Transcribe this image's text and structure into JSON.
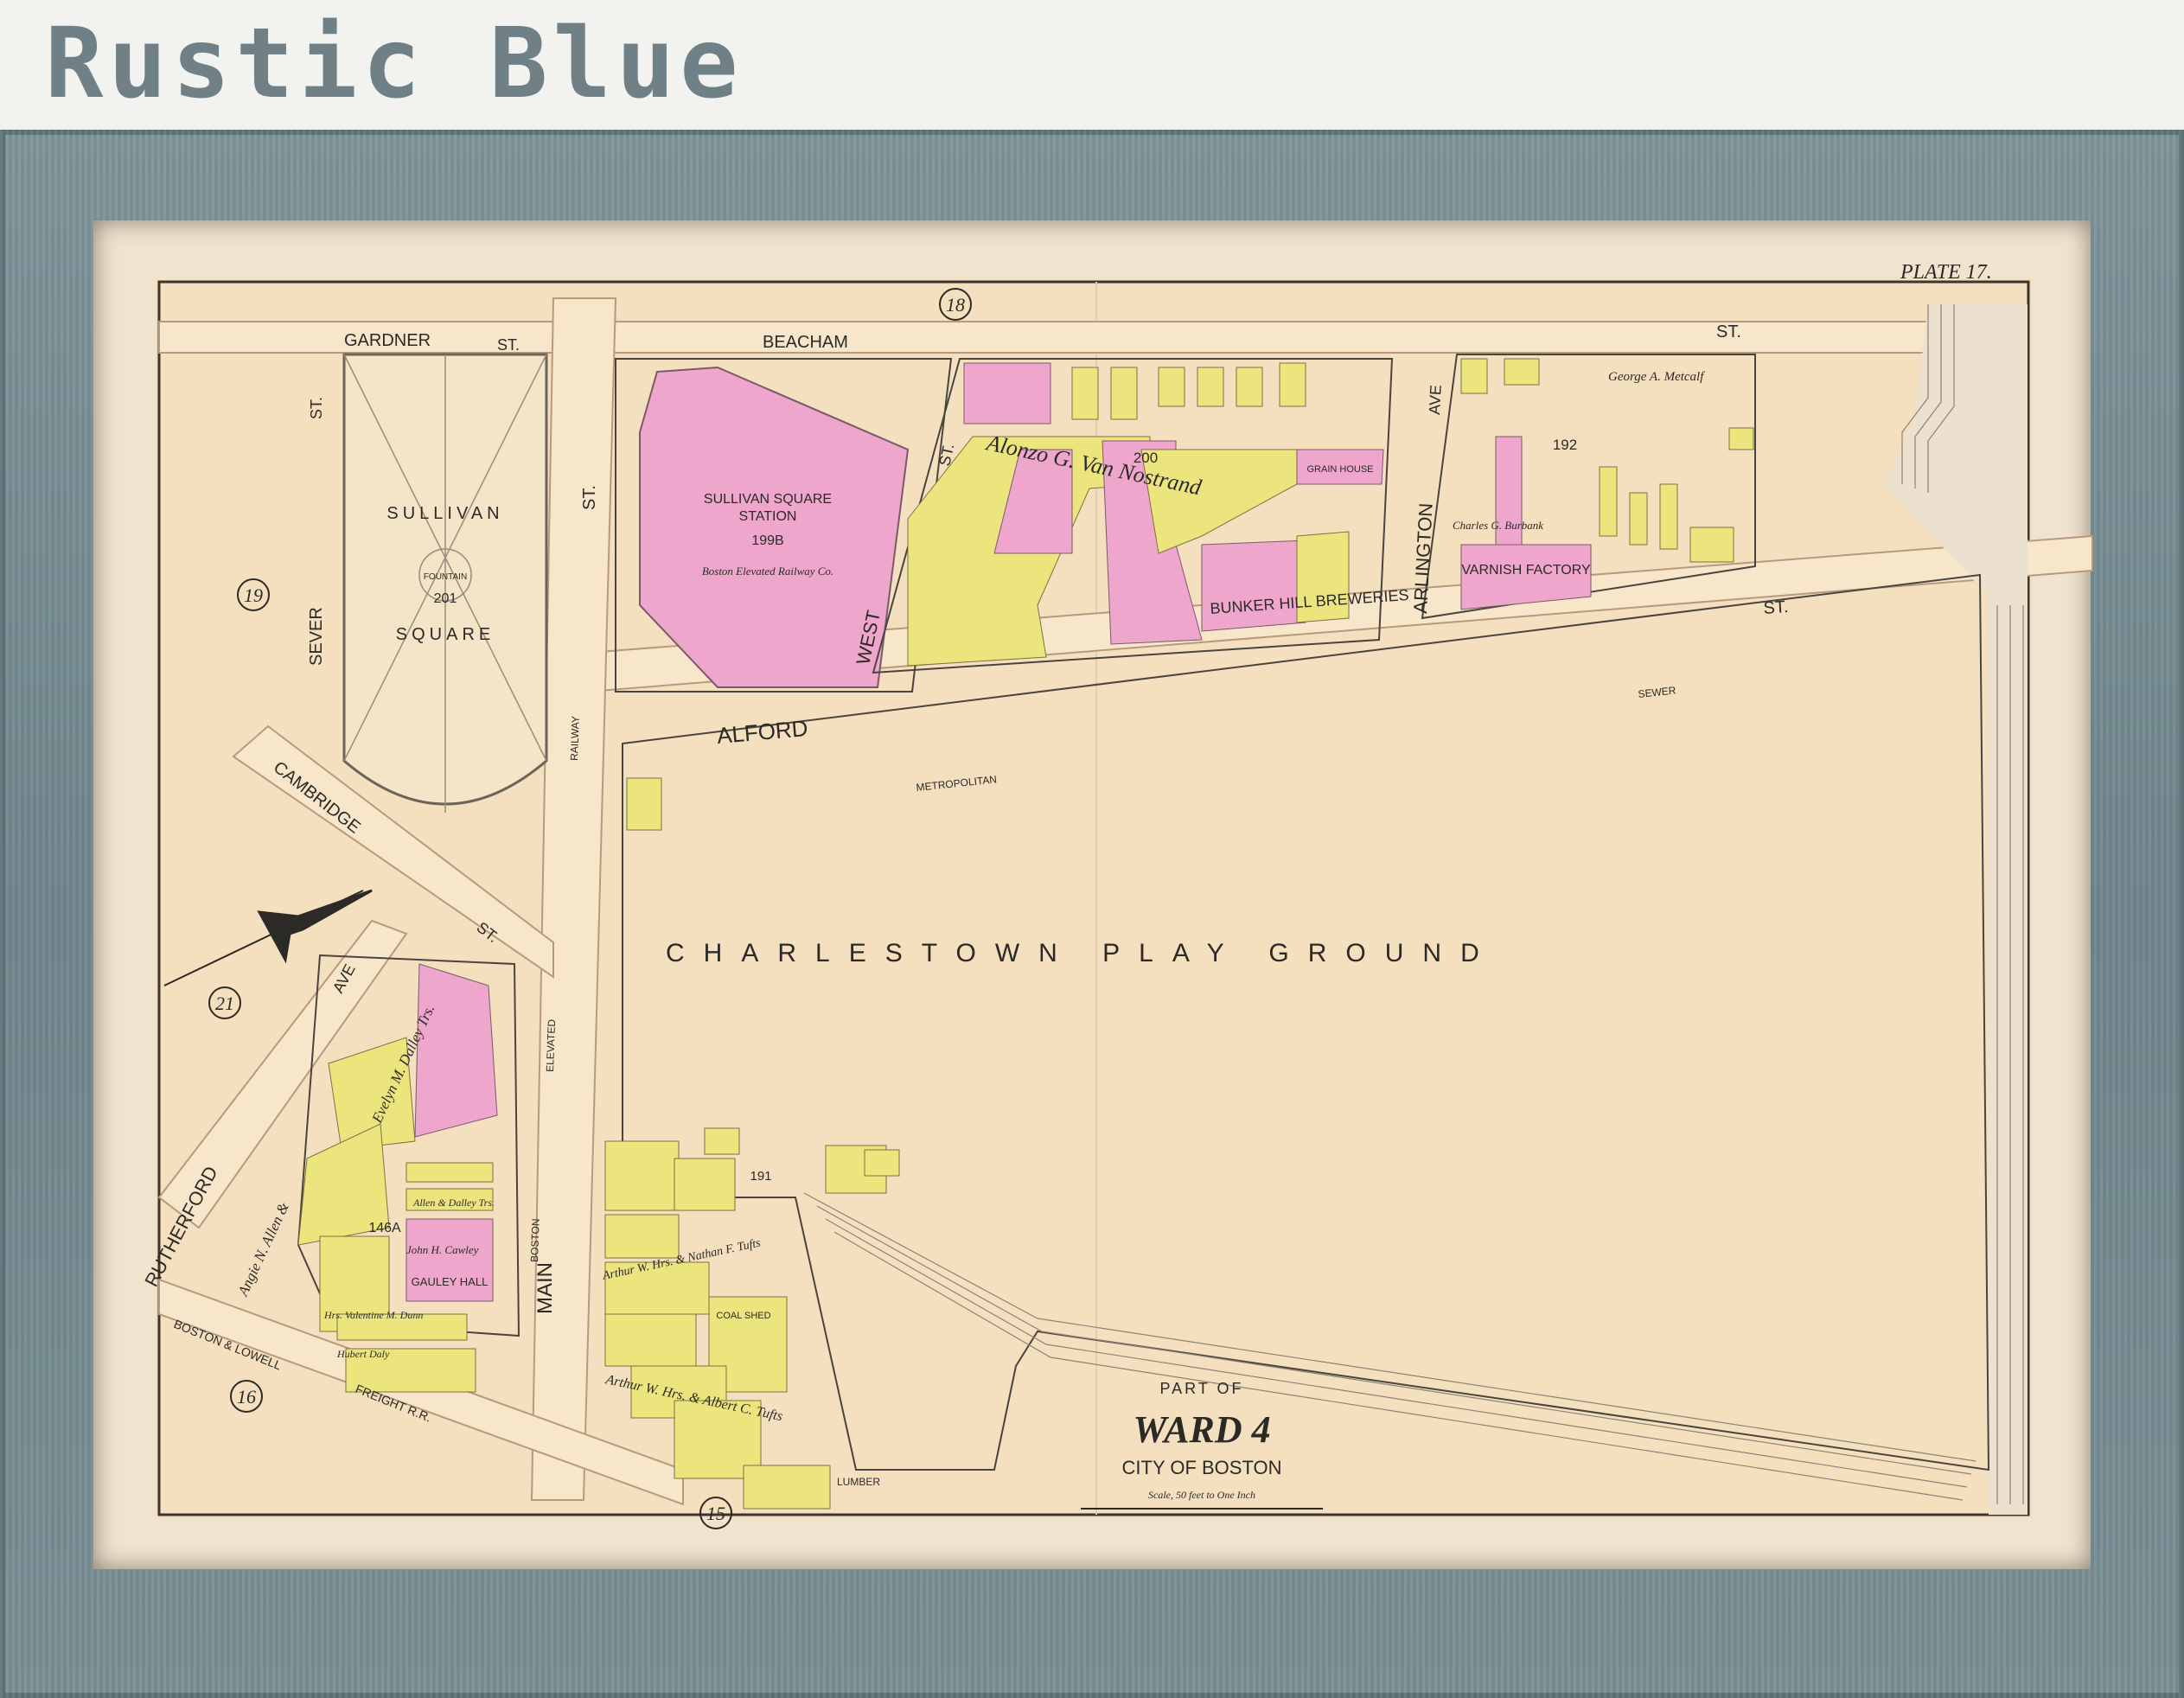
{
  "heading": "Rustic Blue",
  "map": {
    "plate": "PLATE 17.",
    "title_part": "PART OF",
    "title_ward": "WARD 4",
    "title_city": "CITY OF BOSTON",
    "scale_text": "Scale, 50 feet to One Inch",
    "plate_refs": [
      "18",
      "19",
      "21",
      "16",
      "15"
    ],
    "streets": {
      "gardner": "GARDNER",
      "gardner_st": "ST.",
      "beacham": "BEACHAM",
      "beacham_st": "ST.",
      "sever": "SEVER",
      "sever_st": "ST.",
      "main_st": "ST.",
      "main": "MAIN",
      "west": "WEST",
      "west_st": "ST.",
      "alford": "ALFORD",
      "alford_st": "ST.",
      "arlington": "ARLINGTON",
      "arlington_ave": "AVE",
      "cambridge": "CAMBRIDGE",
      "cambridge_st": "ST.",
      "rutherford": "RUTHERFORD",
      "rutherford_ave": "AVE",
      "metropolitan": "METROPOLITAN",
      "sewer": "SEWER",
      "railway": "RAILWAY",
      "elevated": "ELEVATED",
      "boston": "BOSTON",
      "boston_lowell": "BOSTON & LOWELL",
      "freight": "FREIGHT R.R."
    },
    "places": {
      "sullivan": "SULLIVAN",
      "square": "SQUARE",
      "fountain": "FOUNTAIN",
      "lot_201": "201",
      "station_1": "SULLIVAN SQUARE",
      "station_2": "STATION",
      "station_lot": "199B",
      "station_owner": "Boston Elevated Railway Co.",
      "lot_200": "200",
      "van_nostrand": "Alonzo G. Van Nostrand",
      "grain_house": "GRAIN HOUSE",
      "breweries": "BUNKER HILL BREWERIES",
      "lot_192": "192",
      "varnish": "VARNISH FACTORY",
      "metcalf": "George A. Metcalf",
      "burbank": "Charles G. Burbank",
      "playground": "CHARLESTOWN PLAY GROUND",
      "lot_191": "191",
      "tufts_1": "Arthur W. Hrs. & Nathan F. Tufts",
      "tufts_2": "Arthur W. Hrs. & Albert C. Tufts",
      "coal_shed": "COAL SHED",
      "lumber": "LUMBER",
      "lot_146a": "146A",
      "gauley_hall": "GAULEY HALL",
      "dalley": "Evelyn M. Dalley Trs.",
      "allen": "Angie N. Allen &",
      "cawley": "John H. Cawley",
      "dunn": "Hrs. Valentine M. Dunn",
      "daly": "Hubert Daly",
      "allen_dalley": "Allen & Dalley Trs."
    }
  }
}
